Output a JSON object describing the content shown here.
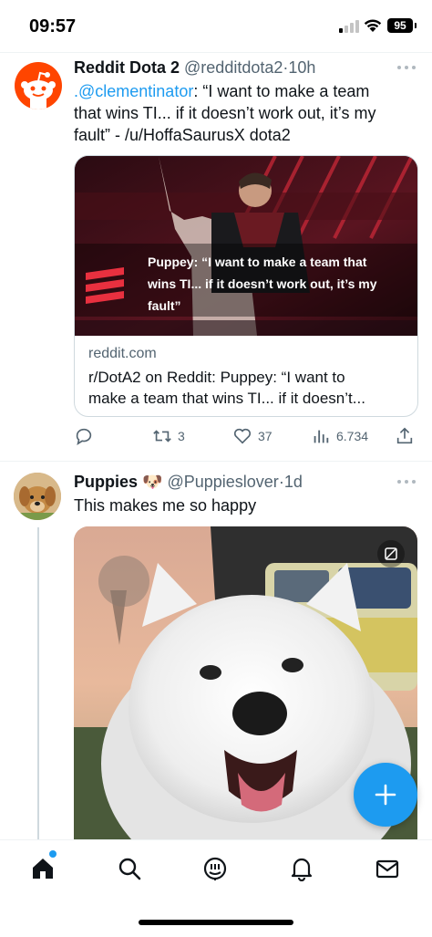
{
  "status_bar": {
    "time": "09:57",
    "battery": "95"
  },
  "tweets": [
    {
      "name": "Reddit Dota 2",
      "handle": "@redditdota2",
      "time": "10h",
      "text_mention": ".@clementinator",
      "text_rest_1": ": “I want to make a team",
      "text_line2": "that wins TI... if it doesn’t work out, it’s my",
      "text_line3": "fault” - /u/HoffaSaurusX dota2",
      "card": {
        "overlay_line1": "Puppey: “I want to make a team that",
        "overlay_line2": "wins TI... if it doesn’t work out, it’s my",
        "overlay_line3": "fault”",
        "domain": "reddit.com",
        "title_line1": "r/DotA2 on Reddit: Puppey: “I want to",
        "title_line2": "make a team that wins TI... if it doesn’t..."
      },
      "actions": {
        "replies": "",
        "retweets": "3",
        "likes": "37",
        "views": "6.734"
      }
    },
    {
      "name": "Puppies",
      "emoji": "🐶",
      "handle": "@Puppieslover",
      "time": "1d",
      "text": "This makes me so happy"
    }
  ],
  "nav": [
    "home-icon",
    "search-icon",
    "grok-icon",
    "bell-icon",
    "mail-icon"
  ],
  "colors": {
    "accent": "#1d9bf0",
    "text": "#0f1419",
    "muted": "#536471"
  }
}
